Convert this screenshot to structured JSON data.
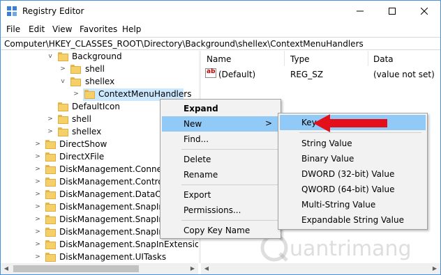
{
  "window": {
    "title": "Registry Editor"
  },
  "menubar": [
    "File",
    "Edit",
    "View",
    "Favorites",
    "Help"
  ],
  "address": "Computer\\HKEY_CLASSES_ROOT\\Directory\\Background\\shellex\\ContextMenuHandlers",
  "tree": {
    "nodes": [
      {
        "label": "Background",
        "chevron": "v"
      },
      {
        "label": "shell",
        "chevron": ">"
      },
      {
        "label": "shellex",
        "chevron": "v"
      },
      {
        "label": "ContextMenuHandlers",
        "chevron": ">"
      },
      {
        "label": "DefaultIcon",
        "chevron": ""
      },
      {
        "label": "shell",
        "chevron": ">"
      },
      {
        "label": "shellex",
        "chevron": ">"
      },
      {
        "label": "DirectShow",
        "chevron": ">"
      },
      {
        "label": "DirectXFile",
        "chevron": ">"
      },
      {
        "label": "DiskManagement.Connecti",
        "chevron": ">"
      },
      {
        "label": "DiskManagement.Control",
        "chevron": ">"
      },
      {
        "label": "DiskManagement.DataObje",
        "chevron": ">"
      },
      {
        "label": "DiskManagement.SnapIn",
        "chevron": ">"
      },
      {
        "label": "DiskManagement.SnapInAb",
        "chevron": ">"
      },
      {
        "label": "DiskManagement.SnapInCo",
        "chevron": ">"
      },
      {
        "label": "DiskManagement.SnapInExtension",
        "chevron": ">"
      },
      {
        "label": "DiskManagement.UITasks",
        "chevron": ">"
      }
    ]
  },
  "values_pane": {
    "headers": {
      "name": "Name",
      "type": "Type",
      "data": "Data"
    },
    "rows": [
      {
        "name": "(Default)",
        "type": "REG_SZ",
        "data": "(value not set)"
      }
    ]
  },
  "context_menu": {
    "items": [
      "Expand",
      "New",
      "Find...",
      "Delete",
      "Rename",
      "Export",
      "Permissions...",
      "Copy Key Name"
    ],
    "submenu_arrow": ">"
  },
  "new_submenu": {
    "items": [
      "Key",
      "String Value",
      "Binary Value",
      "DWORD (32-bit) Value",
      "QWORD (64-bit) Value",
      "Multi-String Value",
      "Expandable String Value"
    ]
  },
  "colors": {
    "highlight": "#91c9f7",
    "arrow": "#e3101c"
  }
}
